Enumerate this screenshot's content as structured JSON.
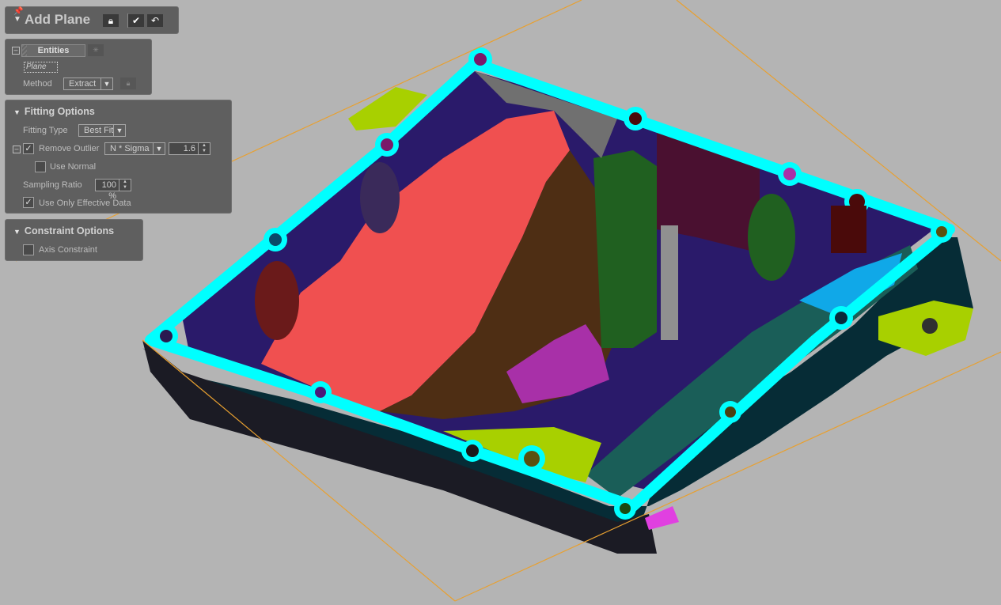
{
  "toolbar": {
    "title": "Add Plane",
    "pin_icon": "pin-icon",
    "lock_icon": "lock-icon",
    "ok_icon": "checkmark-icon",
    "undo_icon": "undo-icon"
  },
  "entities": {
    "button_label": "Entities",
    "selected_item": "Plane",
    "method_label": "Method",
    "method_value": "Extract"
  },
  "fitting": {
    "title": "Fitting Options",
    "fitting_type_label": "Fitting Type",
    "fitting_type_value": "Best Fit",
    "remove_outlier_label": "Remove Outlier",
    "remove_outlier_checked": true,
    "outlier_method": "N * Sigma",
    "outlier_value": "1.6",
    "use_normal_label": "Use Normal",
    "use_normal_checked": false,
    "sampling_ratio_label": "Sampling Ratio",
    "sampling_ratio_value": "100 %",
    "effective_data_label": "Use Only Effective Data",
    "effective_data_checked": true
  },
  "constraint": {
    "title": "Constraint Options",
    "axis_constraint_label": "Axis Constraint",
    "axis_constraint_checked": false
  },
  "viewport": {
    "background": "#b4b4b4",
    "plane_outline_color": "#e8a030",
    "flange_color": "#00ffff",
    "region_colors": [
      "#f05050",
      "#4e2e14",
      "#a830a8",
      "#1a5e58",
      "#2a1a6a",
      "#206020",
      "#4a1030",
      "#a8d000",
      "#06303a"
    ]
  }
}
